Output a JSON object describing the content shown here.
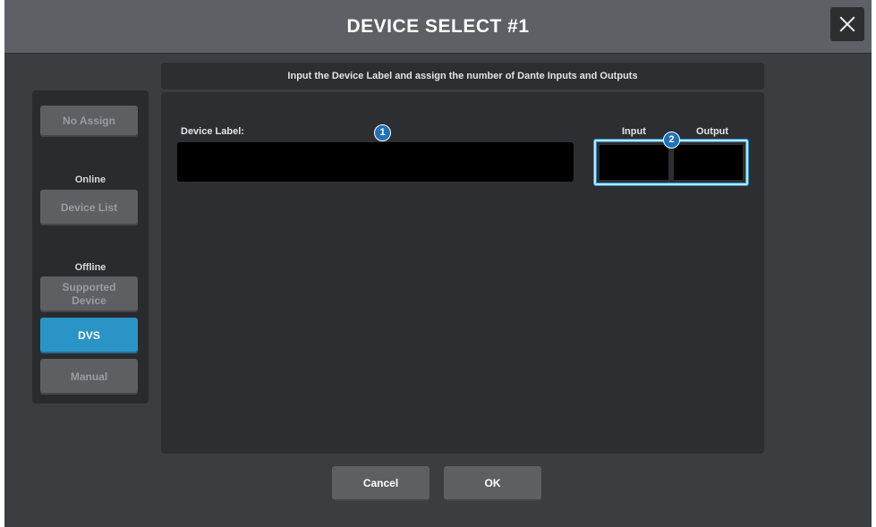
{
  "dialog": {
    "title": "DEVICE SELECT #1",
    "instruction": "Input the Device Label and assign the number of Dante Inputs and Outputs"
  },
  "sidebar": {
    "no_assign": "No Assign",
    "online_label": "Online",
    "device_list": "Device List",
    "offline_label": "Offline",
    "supported_device": "Supported Device",
    "dvs": "DVS",
    "manual": "Manual",
    "active_item": "DVS"
  },
  "form": {
    "device_label_caption": "Device Label:",
    "device_label_value": "",
    "input_caption": "Input",
    "output_caption": "Output",
    "input_value": "",
    "output_value": ""
  },
  "callouts": {
    "one": "1",
    "two": "2"
  },
  "footer": {
    "cancel": "Cancel",
    "ok": "OK"
  },
  "colors": {
    "accent": "#2b94c6",
    "title_bar": "#5f6065",
    "background": "#3c3d40",
    "panel": "#2d2e31"
  }
}
